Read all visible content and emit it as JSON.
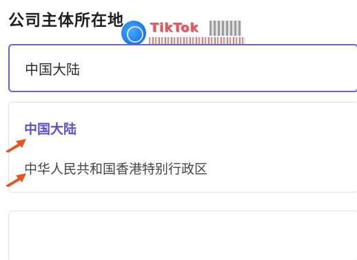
{
  "form": {
    "section_title": "公司主体所在地",
    "selected_value": "中国大陆"
  },
  "dropdown": {
    "options": [
      {
        "label": "中国大陆",
        "selected": true
      },
      {
        "label": "中华人民共和国香港特别行政区",
        "selected": false
      }
    ]
  },
  "watermark": {
    "text": "TikTok",
    "logo_icon": "globe-logo-icon"
  },
  "colors": {
    "accent": "#5b4fd0",
    "border_focus": "#6a5fd3",
    "annotation_arrow": "#e8541e"
  },
  "icons": [
    "pointer-arrow-icon"
  ]
}
